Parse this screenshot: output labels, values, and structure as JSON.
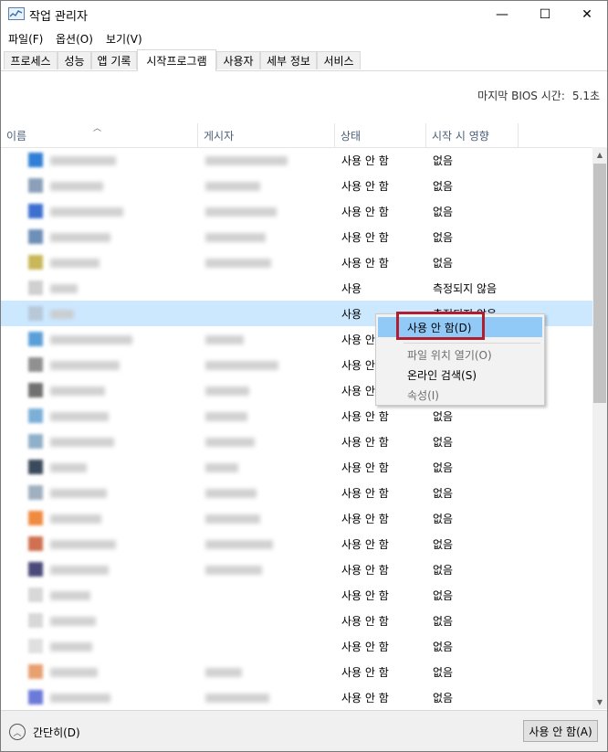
{
  "window": {
    "title": "작업 관리자"
  },
  "window_controls": {
    "minimize": "—",
    "maximize": "☐",
    "close": "✕"
  },
  "menu": [
    "파일(F)",
    "옵션(O)",
    "보기(V)"
  ],
  "tabs": [
    {
      "label": "프로세스",
      "active": false
    },
    {
      "label": "성능",
      "active": false
    },
    {
      "label": "앱 기록",
      "active": false
    },
    {
      "label": "시작프로그램",
      "active": true
    },
    {
      "label": "사용자",
      "active": false
    },
    {
      "label": "세부 정보",
      "active": false
    },
    {
      "label": "서비스",
      "active": false
    }
  ],
  "bios": {
    "label": "마지막 BIOS 시간:",
    "value": "5.1초"
  },
  "columns": {
    "name": "이름",
    "publisher": "게시자",
    "status": "상태",
    "impact": "시작 시 영향"
  },
  "rows": [
    {
      "status": "사용 안 함",
      "impact": "없음",
      "icon_color": "#2f7fd6"
    },
    {
      "status": "사용 안 함",
      "impact": "없음",
      "icon_color": "#8aa0b8"
    },
    {
      "status": "사용 안 함",
      "impact": "없음",
      "icon_color": "#3c6fd0"
    },
    {
      "status": "사용 안 함",
      "impact": "없음",
      "icon_color": "#6e8fb8"
    },
    {
      "status": "사용 안 함",
      "impact": "없음",
      "icon_color": "#c8b85a"
    },
    {
      "status": "사용",
      "impact": "측정되지 않음",
      "icon_color": "#d0d0d0"
    },
    {
      "status": "사용",
      "impact": "측정되지 않음",
      "icon_color": "#b8c8d8"
    },
    {
      "status": "사용 안 함",
      "impact": "없음",
      "icon_color": "#5aa0d8"
    },
    {
      "status": "사용 안 함",
      "impact": "없음",
      "icon_color": "#909090"
    },
    {
      "status": "사용 안 함",
      "impact": "없음",
      "icon_color": "#707070"
    },
    {
      "status": "사용 안 함",
      "impact": "없음",
      "icon_color": "#7ab0d8"
    },
    {
      "status": "사용 안 함",
      "impact": "없음",
      "icon_color": "#8fb0c8"
    },
    {
      "status": "사용 안 함",
      "impact": "없음",
      "icon_color": "#3a4a5a"
    },
    {
      "status": "사용 안 함",
      "impact": "없음",
      "icon_color": "#a0b0c0"
    },
    {
      "status": "사용 안 함",
      "impact": "없음",
      "icon_color": "#f08a40"
    },
    {
      "status": "사용 안 함",
      "impact": "없음",
      "icon_color": "#d07050"
    },
    {
      "status": "사용 안 함",
      "impact": "없음",
      "icon_color": "#4a4a7a"
    },
    {
      "status": "사용 안 함",
      "impact": "없음",
      "icon_color": "#d8d8d8"
    },
    {
      "status": "사용 안 함",
      "impact": "없음",
      "icon_color": "#d8d8d8"
    },
    {
      "status": "사용 안 함",
      "impact": "없음",
      "icon_color": "#e0e0e0"
    },
    {
      "status": "사용 안 함",
      "impact": "없음",
      "icon_color": "#e8a070"
    },
    {
      "status": "사용 안 함",
      "impact": "없음",
      "icon_color": "#6a7ad8"
    }
  ],
  "selected_row": 6,
  "context_menu": {
    "items": [
      {
        "label": "사용 안 함(D)",
        "state": "hover"
      },
      {
        "label": "파일 위치 열기(O)",
        "state": "disabled"
      },
      {
        "label": "온라인 검색(S)",
        "state": "enabled"
      },
      {
        "label": "속성(I)",
        "state": "disabled"
      }
    ],
    "highlight_color": "#b11e2f"
  },
  "footer": {
    "fewer_details": "간단히(D)",
    "disable_button": "사용 안 함(A)"
  }
}
